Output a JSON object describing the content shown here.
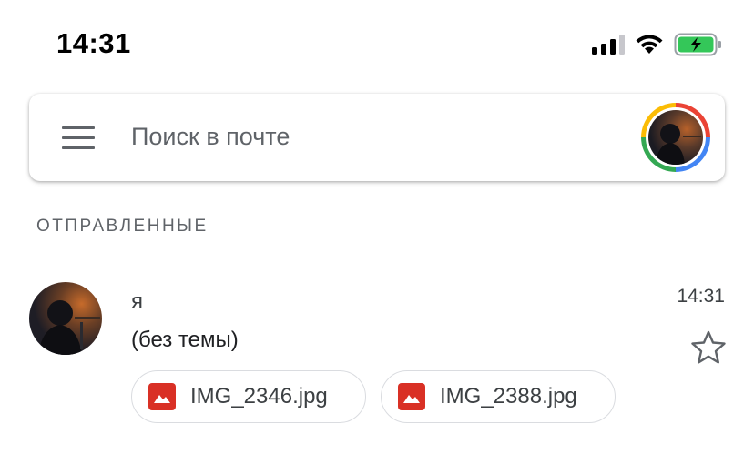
{
  "status_bar": {
    "time": "14:31",
    "icons": [
      "cellular-signal-icon",
      "wifi-icon",
      "battery-charging-icon"
    ],
    "battery_color": "#34c759"
  },
  "search": {
    "placeholder": "Поиск в почте",
    "menu_icon": "hamburger-menu-icon"
  },
  "section": {
    "label": "ОТПРАВЛЕННЫЕ"
  },
  "mail": {
    "sender": "я",
    "time": "14:31",
    "subject": "(без темы)",
    "attachments": [
      {
        "name": "IMG_2346.jpg",
        "icon": "image-icon"
      },
      {
        "name": "IMG_2388.jpg",
        "icon": "image-icon"
      }
    ],
    "starred": false
  },
  "colors": {
    "attachment_icon": "#d93025",
    "google_red": "#ea4335",
    "google_blue": "#4285f4",
    "google_green": "#34a853",
    "google_yellow": "#fbbc05"
  }
}
